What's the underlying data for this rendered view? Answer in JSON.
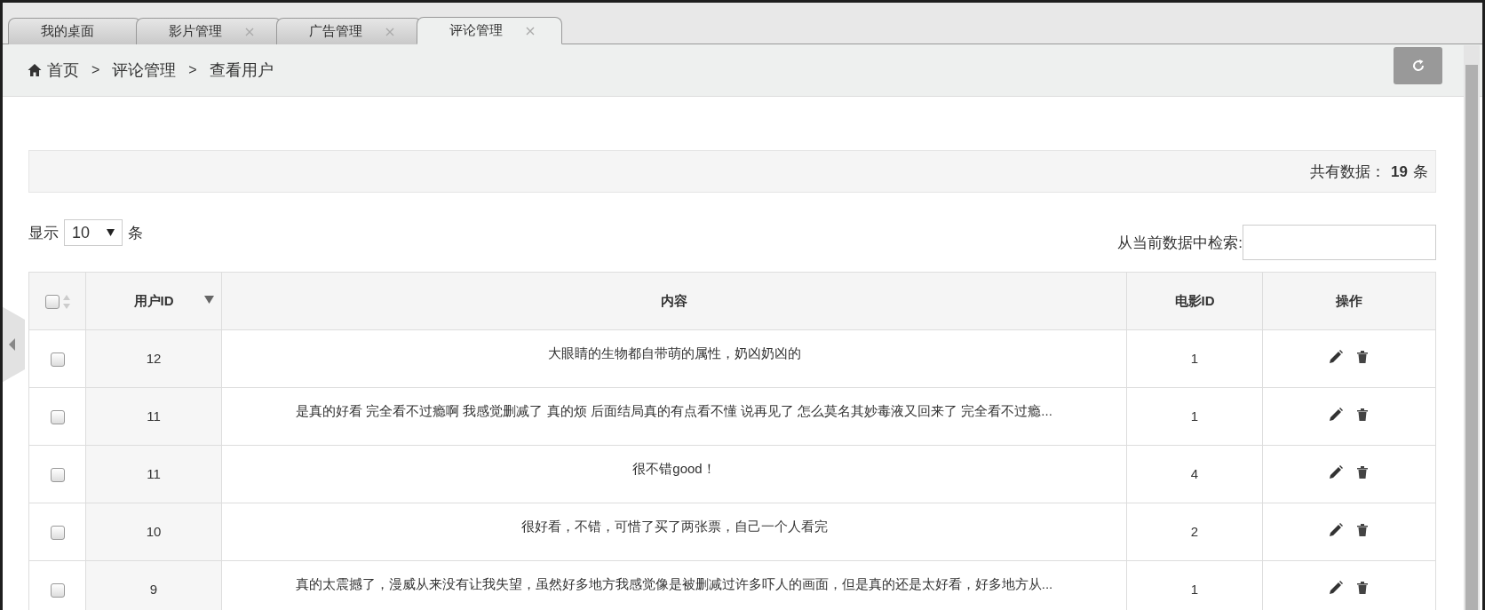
{
  "tabs": [
    {
      "label": "我的桌面",
      "closable": false,
      "selected": false
    },
    {
      "label": "影片管理",
      "closable": true,
      "selected": false
    },
    {
      "label": "广告管理",
      "closable": true,
      "selected": false
    },
    {
      "label": "评论管理",
      "closable": true,
      "selected": true
    }
  ],
  "breadcrumb": [
    {
      "label": "首页"
    },
    {
      "separator": ">",
      "label": "评论管理"
    },
    {
      "separator": ">",
      "label": "查看用户"
    }
  ],
  "stats": {
    "label": "共有数据：",
    "count": "19",
    "unit": "条"
  },
  "page_length": {
    "prefix": "显示",
    "value": "10",
    "suffix": "条"
  },
  "search": {
    "label": "从当前数据中检索:"
  },
  "table": {
    "columns": [
      {
        "kind": "checkbox",
        "checked": false,
        "sorted": false
      },
      {
        "kind": "text",
        "label": "用户ID",
        "sorted": true
      },
      {
        "kind": "text",
        "label": "内容"
      },
      {
        "kind": "text",
        "label": "电影ID"
      },
      {
        "kind": "text",
        "label": "操作"
      }
    ],
    "rows": [
      {
        "checked": false,
        "user_id": "12",
        "content": "大眼睛的生物都自带萌的属性，奶凶奶凶的",
        "movie_id": "1"
      },
      {
        "checked": false,
        "user_id": "11",
        "content": "是真的好看 完全看不过瘾啊 我感觉删减了 真的烦 后面结局真的有点看不懂 说再见了 怎么莫名其妙毒液又回来了 完全看不过瘾...",
        "movie_id": "1"
      },
      {
        "checked": false,
        "user_id": "11",
        "content": "很不错good！",
        "movie_id": "4"
      },
      {
        "checked": false,
        "user_id": "10",
        "content": "很好看，不错，可惜了买了两张票，自己一个人看完",
        "movie_id": "2"
      },
      {
        "checked": false,
        "user_id": "9",
        "content": "真的太震撼了，漫威从来没有让我失望，虽然好多地方我感觉像是被删减过许多吓人的画面，但是真的还是太好看，好多地方从...",
        "movie_id": "1"
      }
    ]
  }
}
